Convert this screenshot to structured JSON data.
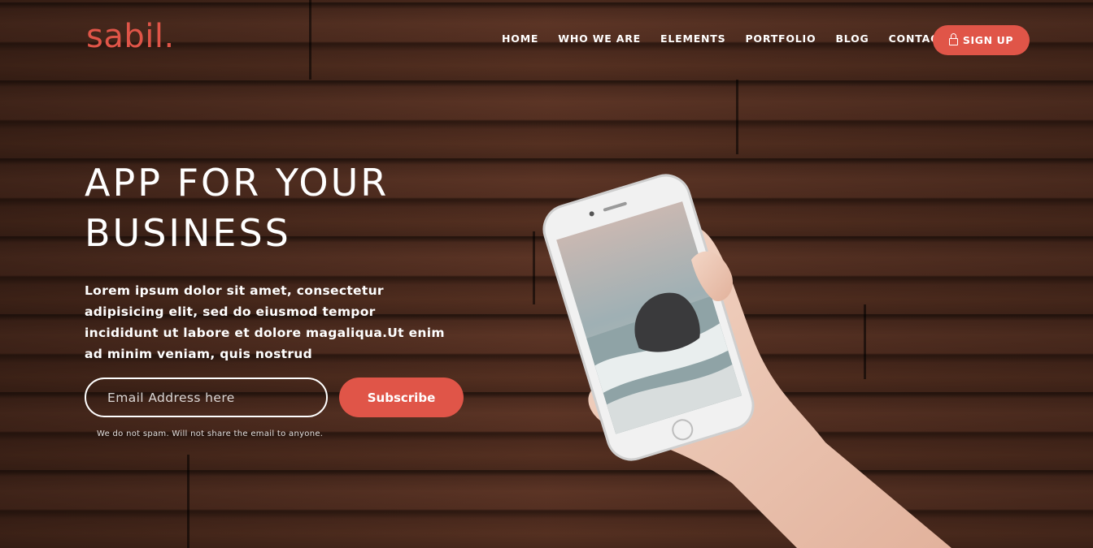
{
  "brand": {
    "logo": "sabil."
  },
  "nav": {
    "items": [
      "HOME",
      "WHO WE ARE",
      "ELEMENTS",
      "PORTFOLIO",
      "BLOG",
      "CONTACT"
    ],
    "signup_label": "SIGN UP",
    "signup_icon": "lock-icon"
  },
  "hero": {
    "title_line1": "APP FOR YOUR",
    "title_line2": "BUSINESS",
    "body": "Lorem ipsum dolor sit amet, consectetur adipisicing elit, sed do eiusmod tempor incididunt ut labore et dolore magaliqua.Ut enim ad minim veniam, quis nostrud",
    "email_placeholder": "Email Address here",
    "subscribe_label": "Subscribe",
    "note": "We do not spam. Will not share the email to anyone."
  },
  "colors": {
    "accent": "#e05548",
    "text": "#ffffff",
    "wood": "#5a3324"
  }
}
